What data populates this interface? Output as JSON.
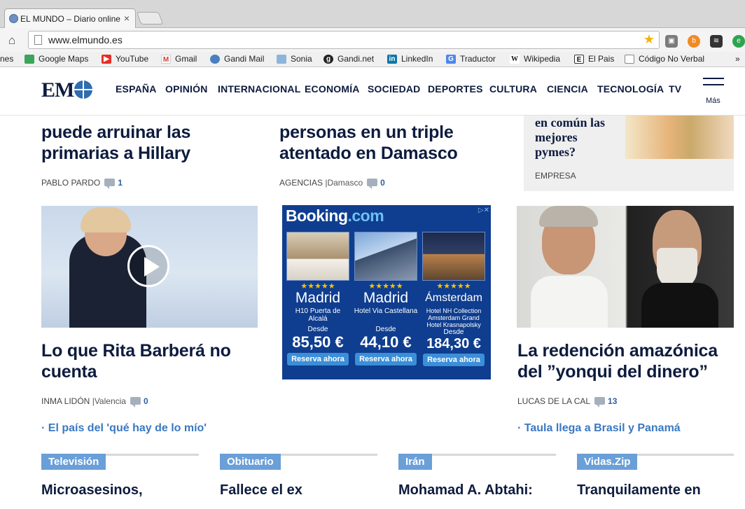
{
  "browser": {
    "tab_title": "EL MUNDO – Diario online",
    "tab_close": "×",
    "url": "www.elmundo.es",
    "bookmarks": [
      {
        "label": "nes",
        "icon": "bookmark-icon"
      },
      {
        "label": "Google Maps",
        "icon": "maps-icon"
      },
      {
        "label": "YouTube",
        "icon": "youtube-icon"
      },
      {
        "label": "Gmail",
        "icon": "gmail-icon"
      },
      {
        "label": "Gandi Mail",
        "icon": "gandi-mail-icon"
      },
      {
        "label": "Sonia",
        "icon": "folder-icon"
      },
      {
        "label": "Gandi.net",
        "icon": "gandi-icon"
      },
      {
        "label": "LinkedIn",
        "icon": "linkedin-icon"
      },
      {
        "label": "Traductor",
        "icon": "translate-icon"
      },
      {
        "label": "Wikipedia",
        "icon": "wikipedia-icon"
      },
      {
        "label": "El Pais",
        "icon": "elpais-icon"
      },
      {
        "label": "Código No Verbal",
        "icon": "page-icon"
      }
    ],
    "more_bookmarks": "»"
  },
  "site": {
    "logo": "EM",
    "nav": [
      "ESPAÑA",
      "OPINIÓN",
      "INTERNACIONAL",
      "ECONOMÍA",
      "SOCIEDAD",
      "DEPORTES",
      "CULTURA",
      "CIENCIA",
      "TECNOLOGÍA",
      "TV"
    ],
    "more": "Más"
  },
  "top_articles": [
    {
      "headline_top": "puede arruinar las",
      "headline_bottom": "primarias a Hillary",
      "author": "PABLO PARDO",
      "location": "",
      "comments": "1"
    },
    {
      "headline_top": "personas en un triple",
      "headline_bottom": "atentado en Damasco",
      "author": "AGENCIAS",
      "location": "Damasco",
      "comments": "0"
    }
  ],
  "sidebox": {
    "lines": [
      "en común las",
      "mejores",
      "pymes?"
    ],
    "category": "EMPRESA"
  },
  "mid_articles": [
    {
      "headline": [
        "Lo que Rita Barberá no",
        "cuenta"
      ],
      "author": "INMA LIDÓN",
      "location": "Valencia",
      "comments": "0",
      "related": "El país del 'qué hay de lo mío'"
    },
    {
      "headline": [
        "La redención amazónica",
        "del ”yonqui del dinero”"
      ],
      "author": "LUCAS DE LA CAL",
      "location": "",
      "comments": "13",
      "related": "Taula llega a Brasil y Panamá"
    }
  ],
  "ad": {
    "brand": "Booking",
    "brand_tld": ".com",
    "hotels": [
      {
        "stars": "★★★★★",
        "city": "Madrid",
        "hotel": "H10 Puerta de Alcalá",
        "desde": "Desde",
        "price": "85,50 €",
        "cta": "Reserva ahora"
      },
      {
        "stars": "★★★★★",
        "city": "Madrid",
        "hotel": "Hotel Via Castellana",
        "desde": "Desde",
        "price": "44,10 €",
        "cta": "Reserva ahora"
      },
      {
        "stars": "★★★★★",
        "city": "Ámsterdam",
        "hotel": "Hotel NH Collection Amsterdam Grand Hotel Krasnapolsky",
        "desde": "Desde",
        "price": "184,30 €",
        "cta": "Reserva ahora"
      }
    ]
  },
  "sections": [
    {
      "tag": "Televisión",
      "headline": "Microasesinos,"
    },
    {
      "tag": "Obituario",
      "headline": "Fallece el ex"
    },
    {
      "tag": "Irán",
      "headline": "Mohamad A. Abtahi:"
    },
    {
      "tag": "Vidas.Zip",
      "headline": "Tranquilamente en"
    }
  ]
}
